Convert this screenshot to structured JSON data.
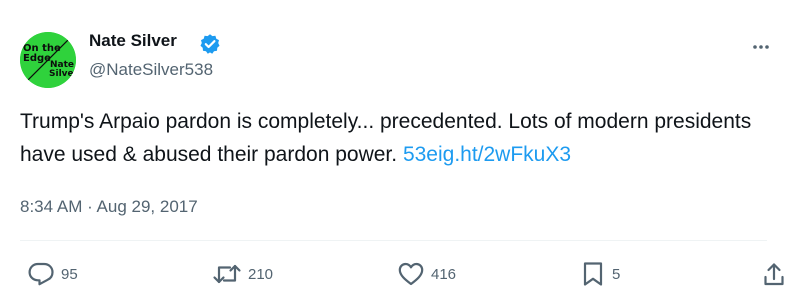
{
  "author": {
    "display_name": "Nate Silver",
    "handle": "@NateSilver538",
    "avatar_text": [
      "On the",
      "Edge",
      "Nate",
      "Silver"
    ],
    "verified_icon": "verified-badge-icon"
  },
  "tweet": {
    "text": "Trump's Arpaio pardon is completely... precedented. Lots of modern presidents have used & abused their pardon power. ",
    "link_text": "53eig.ht/2wFkuX3",
    "timestamp": "8:34 AM · Aug 29, 2017"
  },
  "actions": {
    "reply_count": "95",
    "retweet_count": "210",
    "like_count": "416",
    "bookmark_count": "5"
  },
  "colors": {
    "text": "#0f1419",
    "muted": "#536471",
    "link": "#1d9bf0",
    "verified": "#1d9bf0",
    "avatar_bg": "#2fd23c"
  }
}
